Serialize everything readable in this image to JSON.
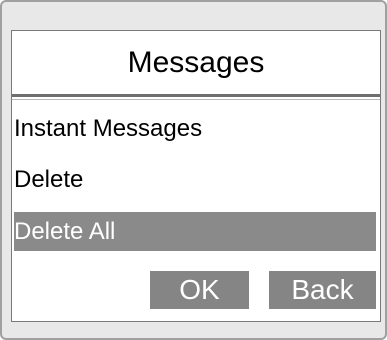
{
  "dialog": {
    "title": "Messages"
  },
  "menu": {
    "items": [
      {
        "label": "Instant Messages",
        "selected": false
      },
      {
        "label": "Delete",
        "selected": false
      },
      {
        "label": "Delete All",
        "selected": true
      }
    ]
  },
  "buttons": {
    "ok_label": "OK",
    "back_label": "Back"
  },
  "colors": {
    "selection": "#8a8a8a",
    "button": "#858585",
    "frame": "#e8e8e8"
  }
}
